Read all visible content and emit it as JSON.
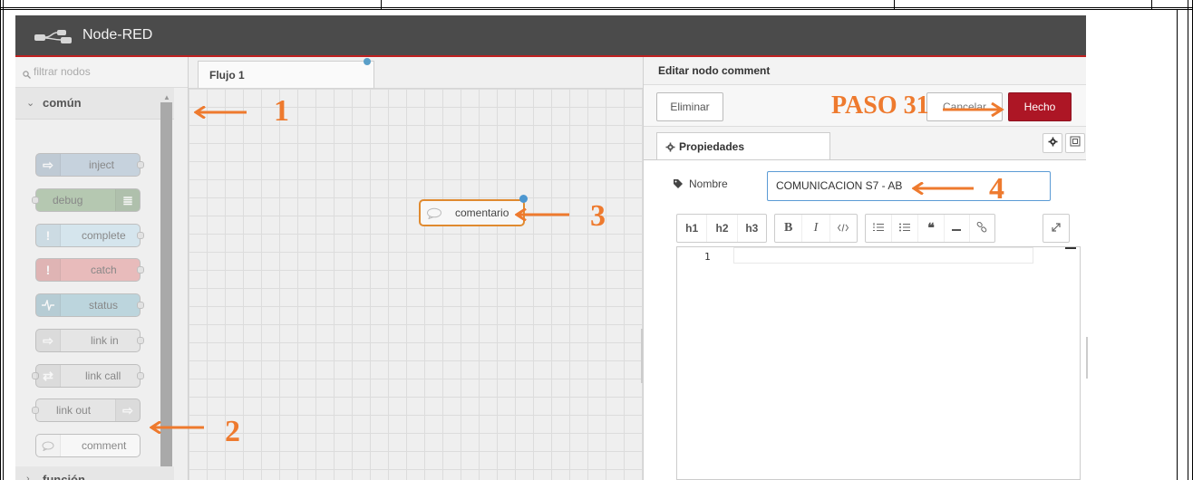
{
  "app": {
    "title": "Node-RED"
  },
  "palette": {
    "filter_placeholder": "filtrar nodos",
    "categories": [
      {
        "label": "común",
        "expanded": true
      },
      {
        "label": "función",
        "expanded": false
      }
    ],
    "nodes": [
      {
        "label": "inject",
        "color": "#a6bbcf"
      },
      {
        "label": "debug",
        "color": "#87a980"
      },
      {
        "label": "complete",
        "color": "#c0deed"
      },
      {
        "label": "catch",
        "color": "#e49191"
      },
      {
        "label": "status",
        "color": "#94c1d0"
      },
      {
        "label": "link in",
        "color": "#dddddd"
      },
      {
        "label": "link call",
        "color": "#dddddd"
      },
      {
        "label": "link out",
        "color": "#dddddd"
      },
      {
        "label": "comment",
        "color": "#ffffff"
      }
    ]
  },
  "workspace": {
    "tab_label": "Flujo 1",
    "comment_node_label": "comentario"
  },
  "editor": {
    "title": "Editar nodo comment",
    "delete_label": "Eliminar",
    "cancel_label": "Cancelar",
    "done_label": "Hecho",
    "properties_tab": "Propiedades",
    "name_label": "Nombre",
    "name_value": "COMUNICACION S7 - AB",
    "md_toolbar": [
      "h1",
      "h2",
      "h3",
      "B",
      "I"
    ],
    "line_number": "1"
  },
  "annotations": {
    "step_title": "PASO 31",
    "marker_1": "1",
    "marker_2": "2",
    "marker_3": "3",
    "marker_4": "4",
    "color": "#ee7a2e"
  },
  "colors": {
    "header_bg": "#4b4b4b",
    "header_accent": "#c02020",
    "done_button": "#ad1625",
    "node_selected": "#e08a2f"
  }
}
